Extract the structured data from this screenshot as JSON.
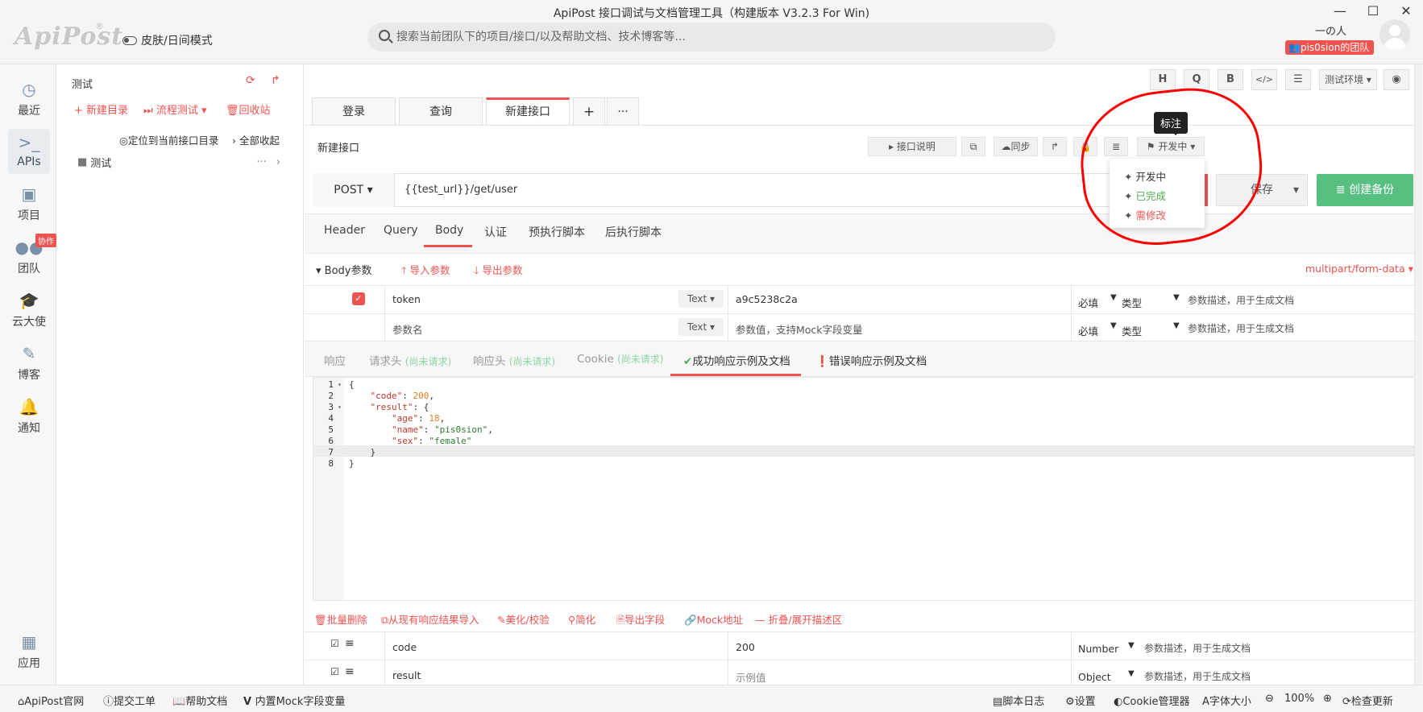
{
  "app": {
    "title": "ApiPost 接口调试与文档管理工具（构建版本 V3.2.3 For Win)",
    "logo": "ApiPost",
    "skin_mode": "皮肤/日间模式",
    "search_placeholder": "搜索当前团队下的项目/接口/以及帮助文档、技术博客等...",
    "user_name": "一の人",
    "team_badge": "pis0sion的团队"
  },
  "nav": {
    "items": [
      {
        "label": "最近",
        "icon": "clock-icon"
      },
      {
        "label": "APIs",
        "icon": "terminal-icon"
      },
      {
        "label": "项目",
        "icon": "project-icon"
      },
      {
        "label": "团队",
        "icon": "team-icon"
      },
      {
        "label": "云大使",
        "icon": "graduation-icon"
      },
      {
        "label": "博客",
        "icon": "edit-icon"
      },
      {
        "label": "通知",
        "icon": "bell-icon"
      },
      {
        "label": "应用",
        "icon": "apps-icon"
      }
    ],
    "collab_badge": "协作"
  },
  "tree": {
    "title": "测试",
    "new_dir": "新建目录",
    "flow_test": "流程测试",
    "recycle": "回收站",
    "locate": "定位到当前接口目录",
    "collapse_all": "全部收起",
    "folder": "测试"
  },
  "toolbar": {
    "h": "H",
    "q": "Q",
    "b": "B",
    "code": "</>",
    "env": "测试环境"
  },
  "tabs": {
    "items": [
      "登录",
      "查询",
      "新建接口"
    ],
    "add": "+",
    "more": "···"
  },
  "api": {
    "name": "新建接口",
    "doc_btn": "接口说明",
    "sync_btn": "同步",
    "status_btn": "开发中",
    "method": "POST",
    "url": "{{test_url}}/get/user",
    "save": "保存",
    "backup": "创建备份"
  },
  "tooltip": "标注",
  "status_dropdown": {
    "items": [
      {
        "label": "开发中",
        "color": "#333333"
      },
      {
        "label": "已完成",
        "color": "#4caf50"
      },
      {
        "label": "需修改",
        "color": "#ef5350"
      }
    ]
  },
  "req_tabs": [
    "Header",
    "Query",
    "Body",
    "认证",
    "预执行脚本",
    "后执行脚本"
  ],
  "body": {
    "label": "Body参数",
    "import": "导入参数",
    "export": "导出参数",
    "content_type": "multipart/form-data",
    "rows": [
      {
        "key": "token",
        "type": "Text",
        "value": "a9c5238c2a",
        "required": "必填",
        "vtype": "类型",
        "desc": "参数描述，用于生成文档"
      },
      {
        "key": "参数名",
        "type": "Text",
        "value": "参数值，支持Mock字段变量",
        "required": "必填",
        "vtype": "类型",
        "desc": "参数描述，用于生成文档"
      }
    ]
  },
  "resp_tabs": {
    "response": "响应",
    "req_header": "请求头",
    "resp_header": "响应头",
    "cookie": "Cookie",
    "not_requested": "(尚未请求)",
    "success": "成功响应示例及文档",
    "error": "错误响应示例及文档"
  },
  "code_lines": [
    "1",
    "2",
    "3",
    "4",
    "5",
    "6",
    "7",
    "8"
  ],
  "actions": {
    "batch_delete": "批量删除",
    "import_resp": "从现有响应结果导入",
    "beautify": "美化/校验",
    "simplify": "简化",
    "export_fields": "导出字段",
    "mock": "Mock地址",
    "fold": "折叠/展开描述区"
  },
  "fields": [
    {
      "name": "code",
      "value": "200",
      "type": "Number",
      "desc": "参数描述，用于生成文档"
    },
    {
      "name": "result",
      "value": "示例值",
      "type": "Object",
      "desc": "参数描述，用于生成文档"
    }
  ],
  "status": {
    "official": "ApiPost官网",
    "ticket": "提交工单",
    "help": "帮助文档",
    "mock_vars": "内置Mock字段变量",
    "script_log": "脚本日志",
    "settings": "设置",
    "cookie_mgr": "Cookie管理器",
    "font_size": "字体大小",
    "zoom": "100%",
    "update": "检查更新"
  }
}
